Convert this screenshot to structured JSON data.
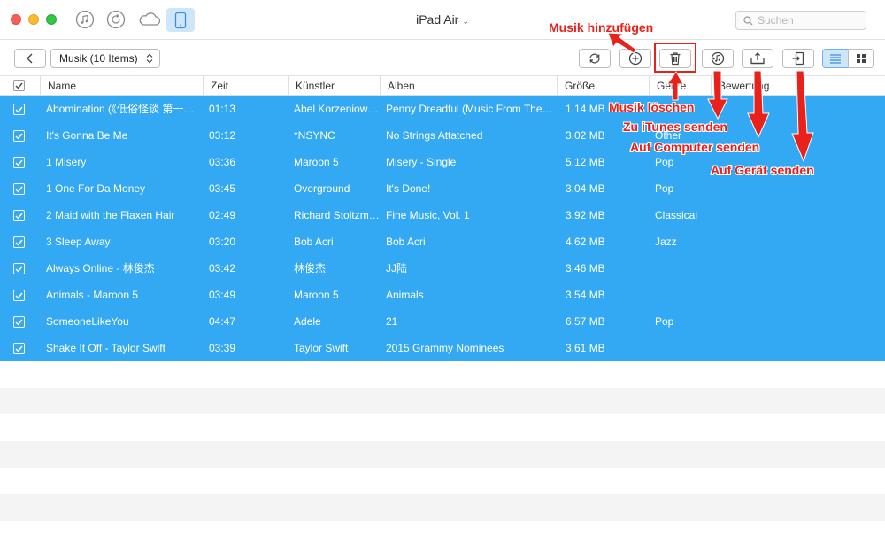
{
  "header": {
    "device_name": "iPad Air",
    "search_placeholder": "Suchen",
    "category_icons": [
      "music-icon",
      "history-icon",
      "cloud-icon",
      "ipad-icon"
    ]
  },
  "toolbar": {
    "category_label": "Musik (10 Items)"
  },
  "columns": [
    "Name",
    "Zeit",
    "Künstler",
    "Alben",
    "Größe",
    "Genre",
    "Bewertung"
  ],
  "rows": [
    {
      "name": "Abomination (《低俗怪谈 第一…",
      "time": "01:13",
      "artist": "Abel Korzeniowski",
      "album": "Penny Dreadful (Music From The…",
      "size": "1.14 MB",
      "genre": ""
    },
    {
      "name": "It's Gonna Be Me",
      "time": "03:12",
      "artist": "*NSYNC",
      "album": "No Strings Attatched",
      "size": "3.02 MB",
      "genre": "Other"
    },
    {
      "name": "1 Misery",
      "time": "03:36",
      "artist": "Maroon 5",
      "album": "Misery - Single",
      "size": "5.12 MB",
      "genre": "Pop"
    },
    {
      "name": "1 One For Da Money",
      "time": "03:45",
      "artist": "Overground",
      "album": "It's Done!",
      "size": "3.04 MB",
      "genre": "Pop"
    },
    {
      "name": "2 Maid with the Flaxen Hair",
      "time": "02:49",
      "artist": "Richard Stoltzm…",
      "album": "Fine Music, Vol. 1",
      "size": "3.92 MB",
      "genre": "Classical"
    },
    {
      "name": "3 Sleep Away",
      "time": "03:20",
      "artist": "Bob Acri",
      "album": "Bob Acri",
      "size": "4.62 MB",
      "genre": "Jazz"
    },
    {
      "name": "Always Online - 林俊杰",
      "time": "03:42",
      "artist": "林俊杰",
      "album": "JJ陆",
      "size": "3.46 MB",
      "genre": ""
    },
    {
      "name": "Animals - Maroon 5",
      "time": "03:49",
      "artist": "Maroon 5",
      "album": "Animals",
      "size": "3.54 MB",
      "genre": ""
    },
    {
      "name": "SomeoneLikeYou",
      "time": "04:47",
      "artist": "Adele",
      "album": "21",
      "size": "6.57 MB",
      "genre": "Pop"
    },
    {
      "name": "Shake It Off - Taylor Swift",
      "time": "03:39",
      "artist": "Taylor Swift",
      "album": "2015 Grammy Nominees",
      "size": "3.61 MB",
      "genre": ""
    }
  ],
  "annotations": {
    "add": "Musik hinzufügen",
    "delete": "Musik löschen",
    "to_itunes": "Zu iTunes senden",
    "to_computer": "Auf Computer senden",
    "to_device": "Auf Gerät senden"
  },
  "colors": {
    "selection": "#34a9f3",
    "annotation": "#e8211b",
    "active_tab": "#cfe6f8"
  }
}
